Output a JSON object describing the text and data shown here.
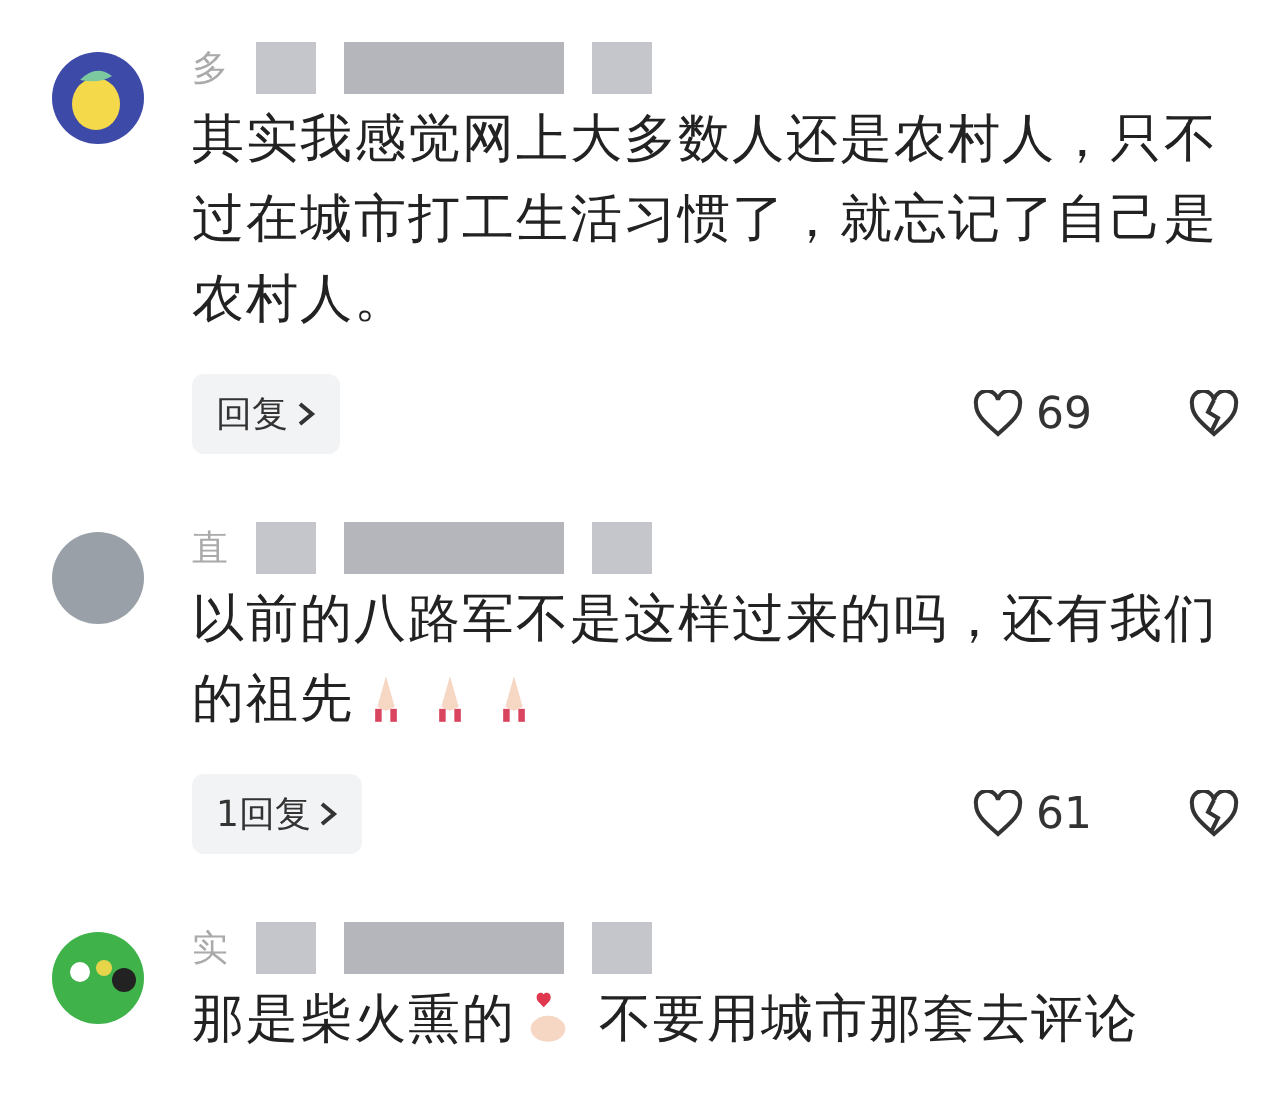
{
  "comments": [
    {
      "avatar": {
        "kind": "lemon"
      },
      "username": "多",
      "text": "其实我感觉网上大多数人还是农村人，只不过在城市打工生活习惯了，就忘记了自己是农村人。",
      "reply_label": "回复",
      "likes": "69"
    },
    {
      "avatar": {
        "kind": "photo"
      },
      "username": "直",
      "text": "以前的八路军不是这样过来的吗，还有我们的祖先",
      "emoji": [
        {
          "kind": "praying-hands"
        },
        {
          "kind": "praying-hands"
        },
        {
          "kind": "praying-hands"
        }
      ],
      "reply_label": "1回复",
      "likes": "61"
    },
    {
      "avatar": {
        "kind": "billiards"
      },
      "username": "实",
      "text": "那是柴火熏的",
      "text_after": "不要用城市那套去评论",
      "emoji": [
        {
          "kind": "finger-heart"
        }
      ]
    }
  ]
}
